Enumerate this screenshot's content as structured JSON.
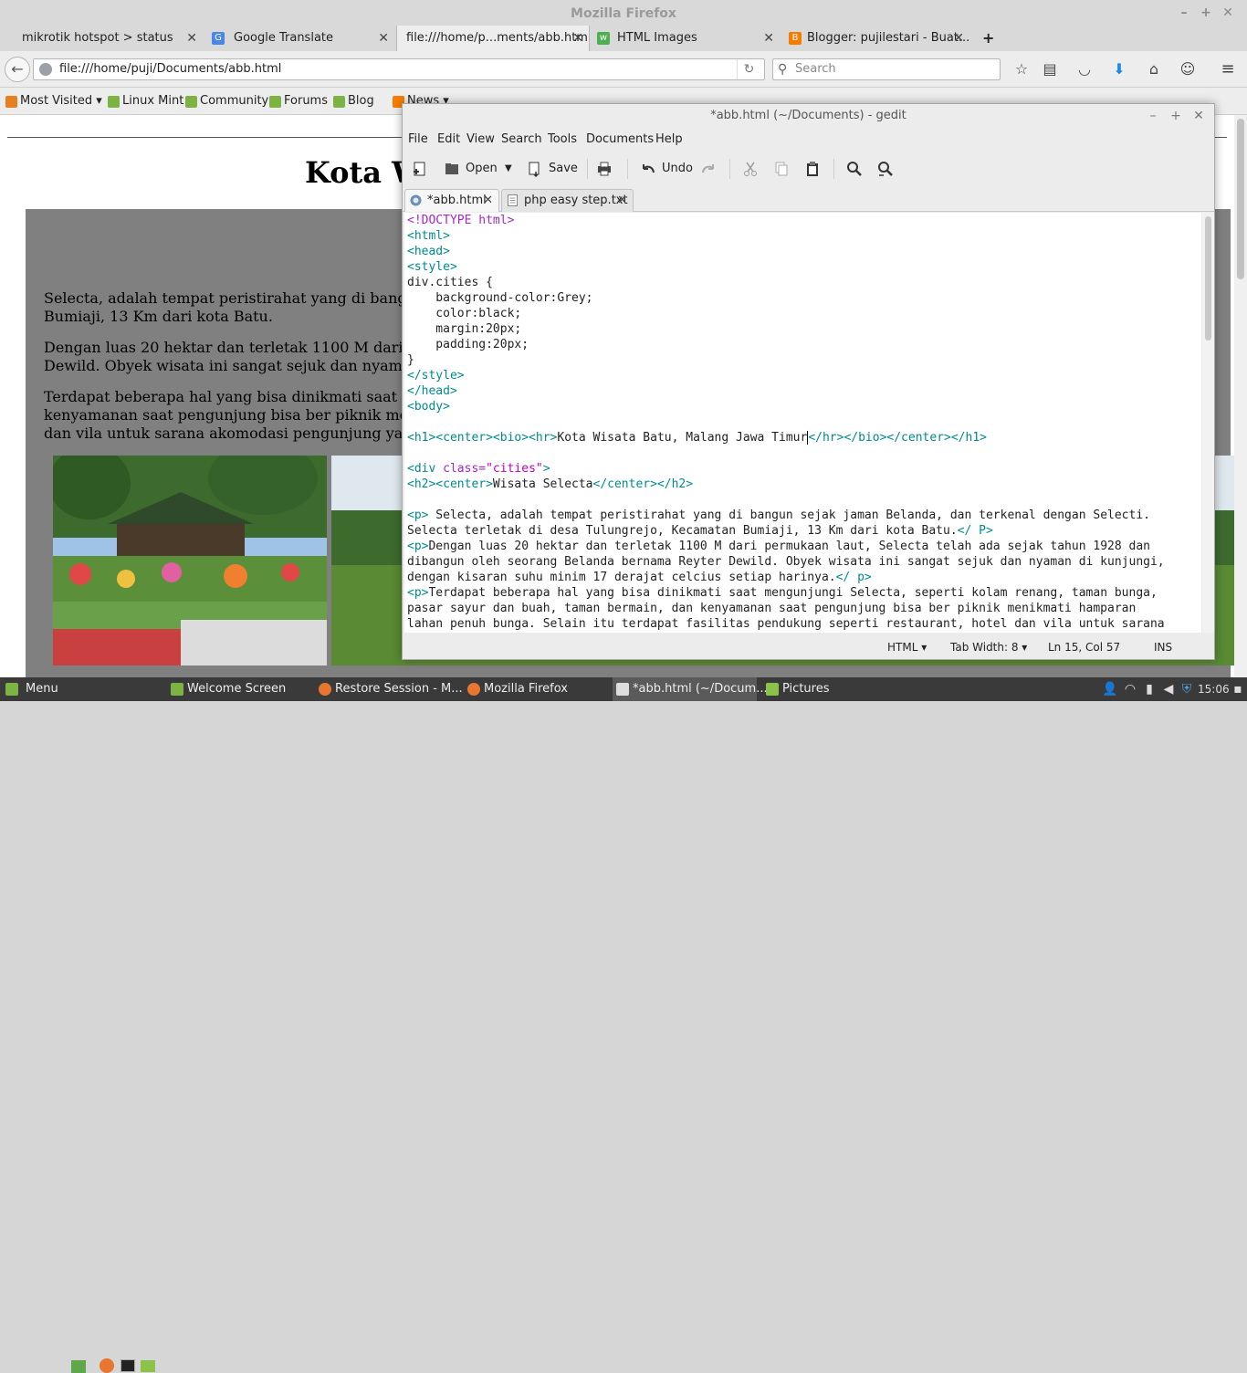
{
  "firefox": {
    "window_title": "Mozilla Firefox",
    "tabs": [
      {
        "label": "mikrotik hotspot > status"
      },
      {
        "label": "Google Translate"
      },
      {
        "label": "file:///home/p...ments/abb.html"
      },
      {
        "label": "HTML Images"
      },
      {
        "label": "Blogger: pujilestari - Buat..."
      }
    ],
    "url": "file:///home/puji/Documents/abb.html",
    "search_placeholder": "Search",
    "bookmarks": [
      {
        "label": "Most Visited"
      },
      {
        "label": "Linux Mint"
      },
      {
        "label": "Community"
      },
      {
        "label": "Forums"
      },
      {
        "label": "Blog"
      },
      {
        "label": "News"
      }
    ]
  },
  "page": {
    "heading": "Kota W",
    "paragraphs": [
      {
        "line1": "Selecta, adalah tempat peristirahat yang di bang",
        "line2": "Bumiaji, 13 Km dari kota Batu."
      },
      {
        "line1": "Dengan luas 20 hektar dan terletak 1100 M dari",
        "line2": "Dewild. Obyek wisata ini sangat sejuk dan nyam"
      },
      {
        "line1": "Terdapat beberapa hal yang bisa dinikmati saat",
        "line2": "kenyamanan saat pengunjung bisa ber piknik me",
        "line3": "dan vila untuk sarana akomodasi pengunjung ya"
      }
    ]
  },
  "gedit": {
    "title": "*abb.html (~/Documents) - gedit",
    "menu": [
      "File",
      "Edit",
      "View",
      "Search",
      "Tools",
      "Documents",
      "Help"
    ],
    "toolbar": {
      "open": "Open",
      "save": "Save",
      "undo": "Undo"
    },
    "tabs": [
      {
        "label": "*abb.html"
      },
      {
        "label": "php easy step.txt"
      }
    ],
    "code": {
      "l1": "<!DOCTYPE html>",
      "l2": "<html>",
      "l3": "<head>",
      "l4": "<style>",
      "l5": "div.cities {",
      "l6": "    background-color:Grey;",
      "l7": "    color:black;",
      "l8": "    margin:20px;",
      "l9": "    padding:20px;",
      "l10": "}",
      "l11": "</style>",
      "l12": "</head>",
      "l13": "<body>",
      "l15a": "<h1><center><bio><hr>",
      "l15b": "Kota Wisata Batu, Malang Jawa Timur",
      "l15c": "</hr></bio></center></h1>",
      "l17a": "<div ",
      "l17b": "class=",
      "l17c": "\"cities\"",
      "l17d": ">",
      "l18a": "<h2><center>",
      "l18b": "Wisata Selecta",
      "l18c": "</center></h2>",
      "l20a": "<p>",
      "l20b": " Selecta, adalah tempat peristirahat yang di bangun sejak jaman Belanda, dan terkenal dengan Selecti.",
      "l21a": "Selecta terletak di desa Tulungrejo, Kecamatan Bumiaji, 13 Km dari kota Batu.",
      "l21b": "</ P>",
      "l22a": "<p>",
      "l22b": "Dengan luas 20 hektar dan terletak 1100 M dari permukaan laut, Selecta telah ada sejak tahun 1928 dan",
      "l23": "dibangun oleh seorang Belanda bernama Reyter Dewild. Obyek wisata ini sangat sejuk dan nyaman di kunjungi,",
      "l24a": "dengan kisaran suhu minim 17 derajat celcius setiap harinya.",
      "l24b": "</ p>",
      "l25a": "<p>",
      "l25b": "Terdapat beberapa hal yang bisa dinikmati saat mengunjungi Selecta, seperti kolam renang, taman bunga,",
      "l26": "pasar sayur dan buah, taman bermain, dan kenyamanan saat pengunjung bisa ber piknik menikmati hamparan",
      "l27": "lahan penuh bunga. Selain itu terdapat fasilitas pendukung seperti restaurant, hotel dan vila untuk sarana"
    },
    "status": {
      "language": "HTML",
      "tab_width": "Tab Width: 8",
      "position": "Ln 15, Col 57",
      "mode": "INS"
    }
  },
  "taskbar": {
    "menu_label": "Menu",
    "items": [
      {
        "label": "Welcome Screen"
      },
      {
        "label": "Restore Session - M..."
      },
      {
        "label": "Mozilla Firefox"
      },
      {
        "label": "*abb.html (~/Docum..."
      },
      {
        "label": "Pictures"
      }
    ],
    "clock": "15:06"
  }
}
